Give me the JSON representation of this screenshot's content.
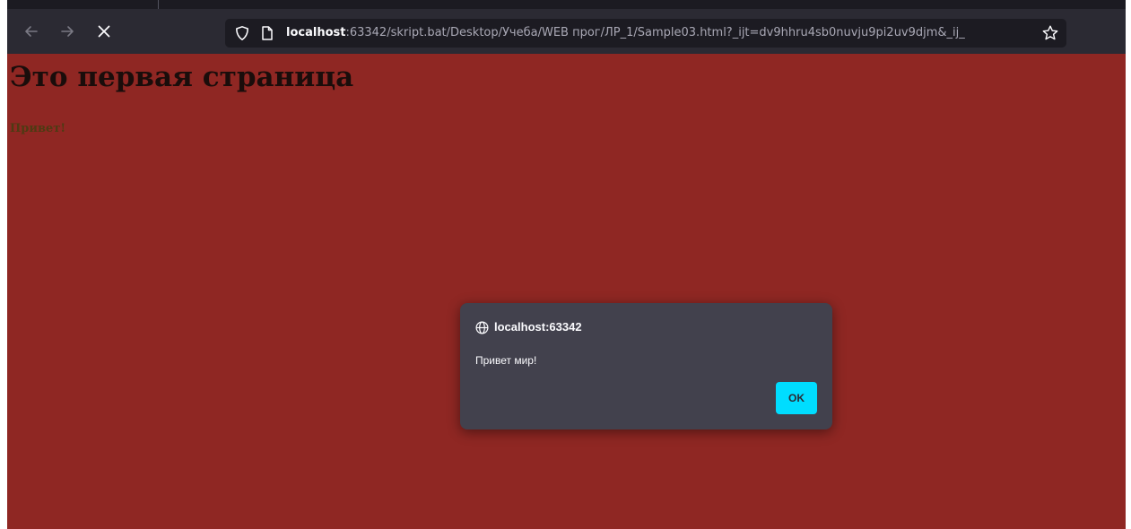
{
  "browser": {
    "url": {
      "host": "localhost",
      "rest": ":63342/skript.bat/Desktop/Учеба/WEB прог/ЛР_1/Sample03.html?_ijt=dv9hhru4sb0nuvju9pi2uv9djm&_ij_"
    },
    "icons": {
      "back": "back-arrow-icon",
      "forward": "forward-arrow-icon",
      "stop": "close-icon",
      "tracking": "shield-icon",
      "page": "page-icon",
      "bookmark": "star-icon"
    }
  },
  "page": {
    "heading": "Это первая страница",
    "greeting": "Привет!",
    "background_color": "#8f2723"
  },
  "alert": {
    "origin": "localhost:63342",
    "message": "Привет мир!",
    "ok_label": "OK",
    "accent_color": "#00ddff"
  }
}
